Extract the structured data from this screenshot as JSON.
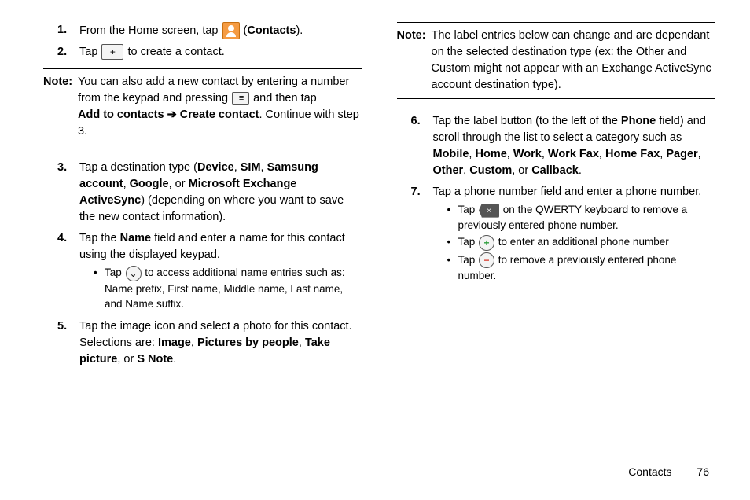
{
  "left": {
    "step1_num": "1.",
    "step1_a": "From the Home screen, tap ",
    "step1_b": " (",
    "step1_c": "Contacts",
    "step1_d": ").",
    "step2_num": "2.",
    "step2_a": "Tap ",
    "step2_b": " to create a contact.",
    "note_label": "Note:",
    "note_a": "You can also add a new contact by entering a number from the keypad and pressing ",
    "note_b": " and then tap ",
    "note_c": "Add to contacts ➔ Create contact",
    "note_d": ". Continue with step 3.",
    "step3_num": "3.",
    "step3_a": "Tap a destination type (",
    "step3_b": "Device",
    "step3_c": ", ",
    "step3_d": "SIM",
    "step3_e": ", ",
    "step3_f": "Samsung account",
    "step3_g": ", ",
    "step3_h": "Google",
    "step3_i": ", or ",
    "step3_j": "Microsoft Exchange ActiveSync",
    "step3_k": ") (depending on where you want to save the new contact information).",
    "step4_num": "4.",
    "step4_a": "Tap the ",
    "step4_b": "Name",
    "step4_c": " field and enter a name for this contact using the displayed keypad.",
    "step4_bullet_a": "Tap ",
    "step4_bullet_b": " to access additional name entries such as: Name prefix, First name, Middle name, Last name, and Name suffix.",
    "step5_num": "5.",
    "step5_a": "Tap the image icon and select a photo for this contact. Selections are: ",
    "step5_b": "Image",
    "step5_c": ", ",
    "step5_d": "Pictures by people",
    "step5_e": ", ",
    "step5_f": "Take picture",
    "step5_g": ", or ",
    "step5_h": "S Note",
    "step5_i": "."
  },
  "right": {
    "note_label": "Note:",
    "note_a": "The label entries below can change and are dependant on the selected destination type (ex: the Other and Custom might not appear with an Exchange ActiveSync account destination type).",
    "step6_num": "6.",
    "step6_a": "Tap the label button (to the left of the ",
    "step6_b": "Phone",
    "step6_c": " field) and scroll through the list to select a category such as ",
    "step6_d": "Mobile",
    "step6_e": ", ",
    "step6_f": "Home",
    "step6_g": ", ",
    "step6_h": "Work",
    "step6_i": ", ",
    "step6_j": "Work Fax",
    "step6_k": ", ",
    "step6_l": "Home Fax",
    "step6_m": ", ",
    "step6_n": "Pager",
    "step6_o": ", ",
    "step6_p": "Other",
    "step6_q": ", ",
    "step6_r": "Custom",
    "step6_s": ", or ",
    "step6_t": "Callback",
    "step6_u": ".",
    "step7_num": "7.",
    "step7_a": "Tap a phone number field and enter a phone number.",
    "step7_b1_a": "Tap ",
    "step7_b1_b": " on the QWERTY keyboard to remove a previously entered phone number.",
    "step7_b2_a": "Tap ",
    "step7_b2_b": " to enter an additional phone number",
    "step7_b3_a": "Tap ",
    "step7_b3_b": " to remove a previously entered phone number."
  },
  "footer": {
    "section": "Contacts",
    "page": "76"
  },
  "icons": {
    "plus": "+",
    "menu": "≡",
    "chevron": "⌄",
    "x": "×",
    "plus_g": "+",
    "minus_r": "−"
  }
}
